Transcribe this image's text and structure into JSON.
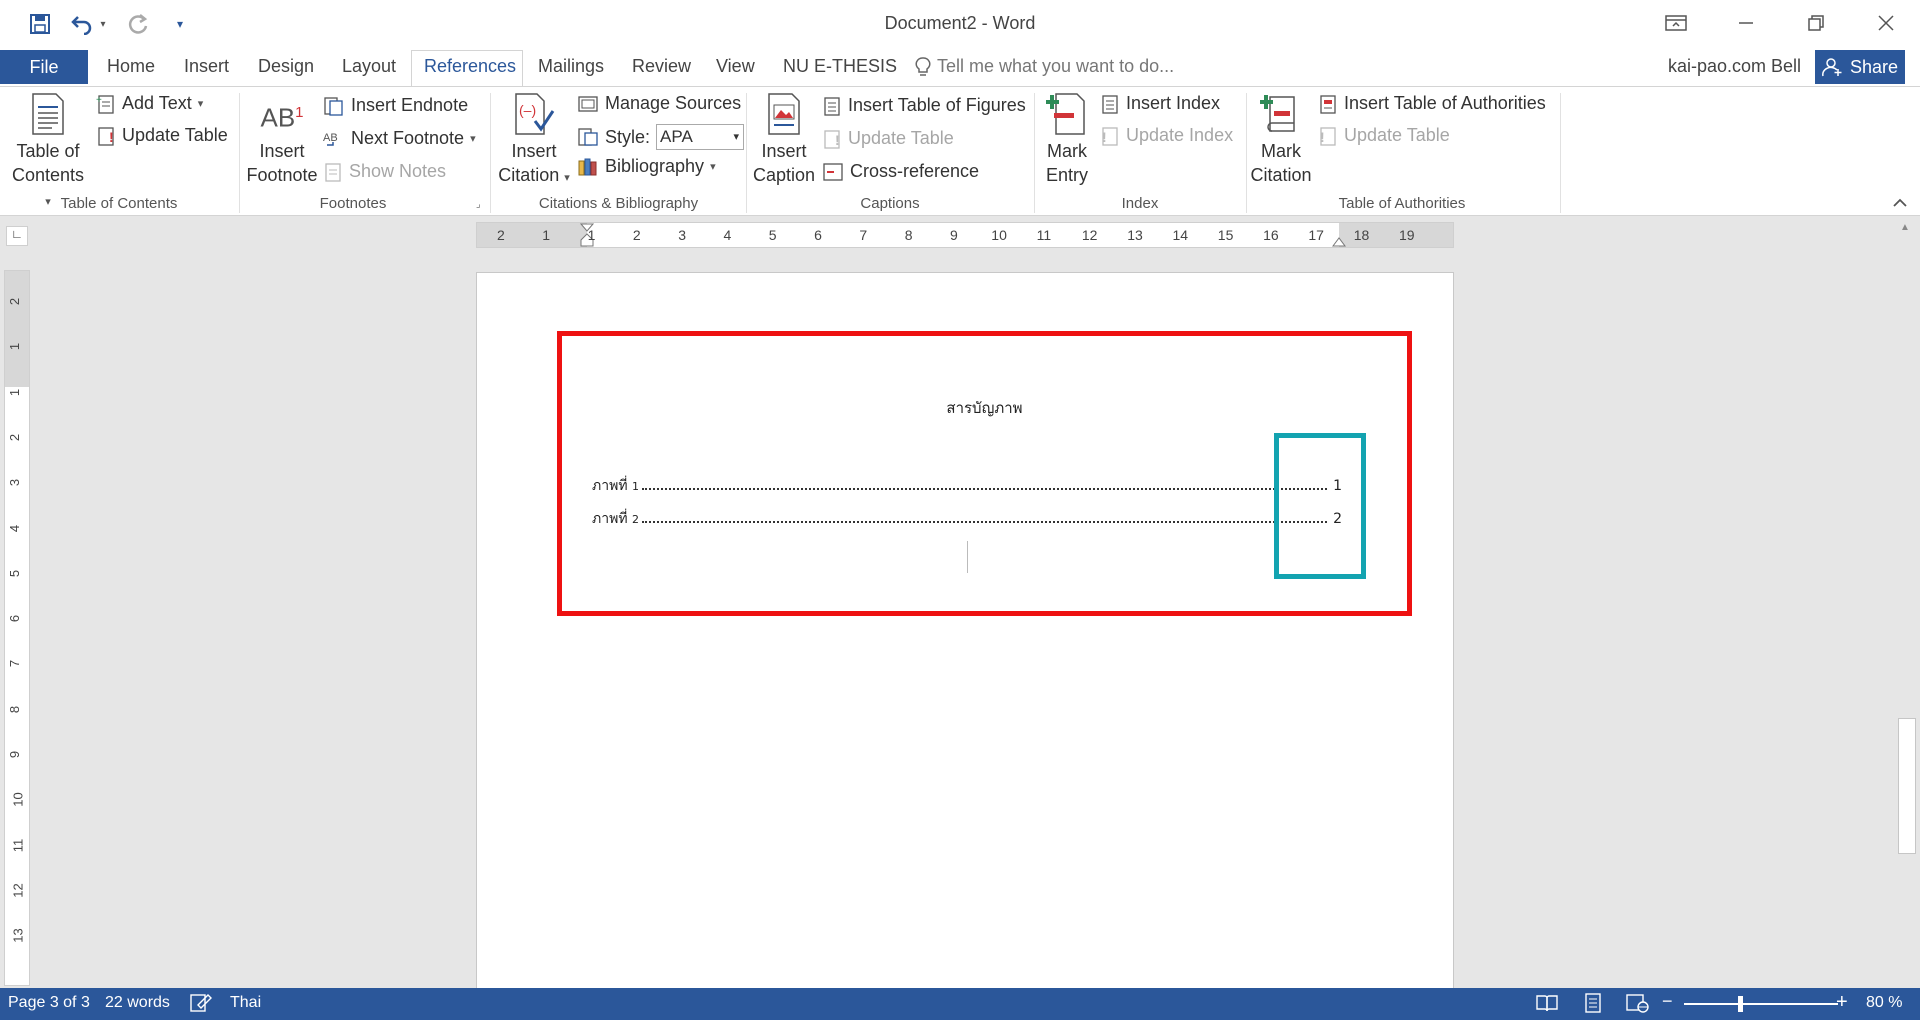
{
  "window": {
    "title": "Document2 - Word",
    "qat": {
      "save_icon": "save-icon",
      "undo_icon": "undo-icon",
      "redo_icon": "redo-icon",
      "customize_icon": "customize-qat-icon"
    },
    "controls": {
      "ribbon_display_icon": "ribbon-display-options-icon",
      "minimize_icon": "minimize-icon",
      "restore_icon": "restore-icon",
      "close_icon": "close-icon"
    }
  },
  "tabs": {
    "file": "File",
    "items": [
      "Home",
      "Insert",
      "Design",
      "Layout",
      "References",
      "Mailings",
      "Review",
      "View",
      "NU E-THESIS"
    ],
    "active": "References",
    "tell_me": "Tell me what you want to do...",
    "user": "kai-pao.com Bell",
    "share": "Share"
  },
  "ribbon": {
    "groups": {
      "toc": "Table of Contents",
      "footnotes": "Footnotes",
      "citations": "Citations & Bibliography",
      "captions": "Captions",
      "index": "Index",
      "toa": "Table of Authorities"
    },
    "toc": {
      "big_line1": "Table of",
      "big_line2": "Contents",
      "add_text": "Add Text",
      "update_table": "Update Table"
    },
    "footnotes": {
      "big_line1": "Insert",
      "big_line2": "Footnote",
      "big_icon_text": "AB",
      "big_icon_sup": "1",
      "insert_endnote": "Insert Endnote",
      "next_footnote": "Next Footnote",
      "show_notes": "Show Notes"
    },
    "citations": {
      "big_line1": "Insert",
      "big_line2": "Citation",
      "manage_sources": "Manage Sources",
      "style_label": "Style:",
      "style_value": "APA",
      "bibliography": "Bibliography"
    },
    "captions": {
      "big_line1": "Insert",
      "big_line2": "Caption",
      "insert_table_of_figures": "Insert Table of Figures",
      "update_table": "Update Table",
      "cross_reference": "Cross-reference"
    },
    "index": {
      "big_line1": "Mark",
      "big_line2": "Entry",
      "insert_index": "Insert Index",
      "update_index": "Update Index"
    },
    "toa": {
      "big_line1": "Mark",
      "big_line2": "Citation",
      "insert_toa": "Insert Table of Authorities",
      "update_table": "Update Table"
    }
  },
  "ruler": {
    "horizontal": [
      "2",
      "1",
      "1",
      "2",
      "3",
      "4",
      "5",
      "6",
      "7",
      "8",
      "9",
      "10",
      "11",
      "12",
      "13",
      "14",
      "15",
      "16",
      "17",
      "18",
      "19"
    ],
    "vertical": [
      "2",
      "1",
      "1",
      "2",
      "3",
      "4",
      "5",
      "6",
      "7",
      "8",
      "9",
      "10",
      "11",
      "12",
      "13"
    ]
  },
  "document": {
    "heading": "สารบัญภาพ",
    "entries": [
      {
        "label": "ภาพที่",
        "num": "1",
        "page": "1"
      },
      {
        "label": "ภาพที่",
        "num": "2",
        "page": "2"
      }
    ],
    "annotation_colors": {
      "outer": "#ee1111",
      "page_numbers": "#13a3b0"
    }
  },
  "status": {
    "page": "Page 3 of 3",
    "words": "22 words",
    "language": "Thai",
    "zoom": "80 %",
    "zoom_minus": "−",
    "zoom_plus": "+",
    "zoom_level_percent": 80
  },
  "colors": {
    "accent": "#2b579a"
  }
}
